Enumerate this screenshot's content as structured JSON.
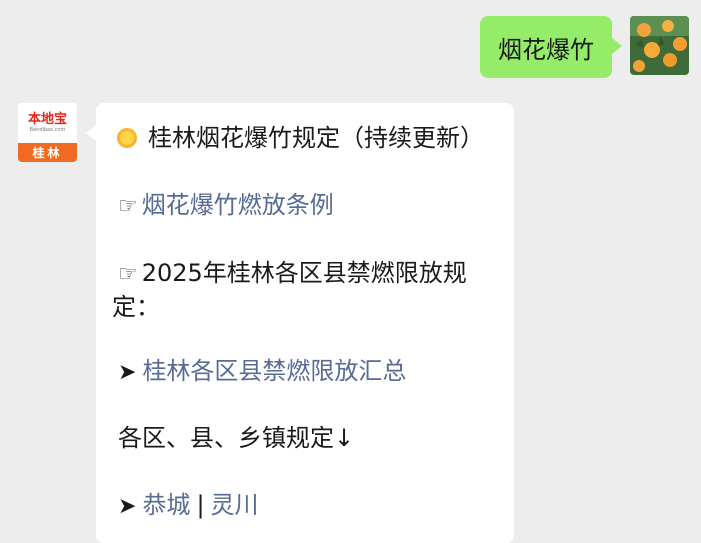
{
  "outgoing": {
    "text": "烟花爆竹"
  },
  "bot": {
    "avatar_brand": "本地宝",
    "avatar_domain": "Bendibao.com",
    "avatar_city": "桂林"
  },
  "message": {
    "title": "桂林烟花爆竹规定（持续更新）",
    "item1_link": "烟花爆竹燃放条例",
    "item2_text_l1": "2025年桂林各区县禁燃限放规",
    "item2_text_l2": "定：",
    "item3_link": "桂林各区县禁燃限放汇总",
    "item4_text": "各区、县、乡镇规定↓",
    "item5_link_a": "恭城",
    "item5_sep": "|",
    "item5_link_b": "灵川"
  },
  "colors": {
    "bubble_out": "#95ec69",
    "link": "#576b95",
    "brand": "#e1271a",
    "band": "#f06b21"
  },
  "icons": [
    "sun-emoji-icon",
    "pointing-hand-icon",
    "right-arrow-icon",
    "orange-fruit-avatar"
  ]
}
